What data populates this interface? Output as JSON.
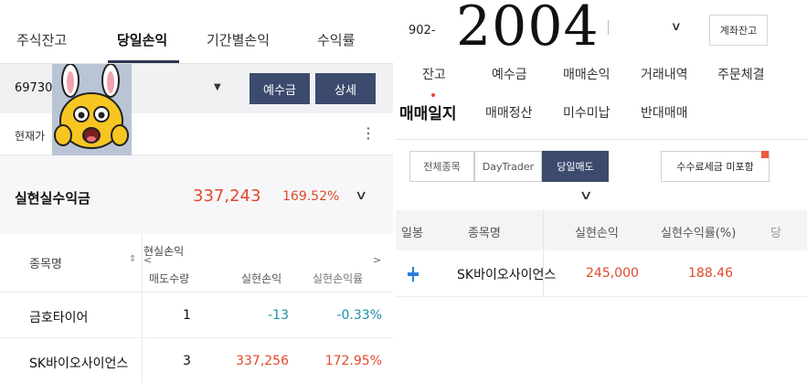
{
  "left": {
    "tabs": [
      "주식잔고",
      "당일손익",
      "기간별손익",
      "수익률"
    ],
    "account": {
      "number": "69730",
      "deposit_button": "예수금",
      "detail_button": "상세"
    },
    "price_label": "현재가",
    "summary": {
      "label": "실현실수익금",
      "amount": "337,243",
      "percent": "169.52%"
    },
    "table": {
      "name_header": "종목명",
      "group_header": "현실손익",
      "nav_left": "<",
      "nav_right": ">",
      "sub_headers": [
        "매도수량",
        "실현손익",
        "실현손익률"
      ],
      "rows": [
        {
          "name": "금호타이어",
          "qty": "1",
          "pl": "-13",
          "rate": "-0.33%",
          "tone": "negative"
        },
        {
          "name": "SK바이오사이언스",
          "qty": "3",
          "pl": "337,256",
          "rate": "172.95%",
          "tone": "positive"
        }
      ]
    },
    "colors": {
      "navy": "#3c4a6e",
      "profit_red": "#e04a2c",
      "loss_blue": "#1e8fa8"
    }
  },
  "right": {
    "account_prefix": "902-",
    "stamp": "2004",
    "balance_button": "계좌잔고",
    "menu_row1": [
      "잔고",
      "예수금",
      "매매손익",
      "거래내역",
      "주문체결"
    ],
    "menu_row2": [
      "매매일지",
      "매매정산",
      "미수미납",
      "반대매매"
    ],
    "segments": [
      "전체종목",
      "DayTrader",
      "당일매도"
    ],
    "fee_button": "수수료세금 미포함",
    "table": {
      "headers": [
        "일봉",
        "종목명",
        "실현손익",
        "실현수익률(%)",
        "당"
      ],
      "rows": [
        {
          "name": "SK바이오사이언스",
          "pl": "245,000",
          "rate": "188.46",
          "icon": "candle-icon"
        }
      ]
    }
  }
}
